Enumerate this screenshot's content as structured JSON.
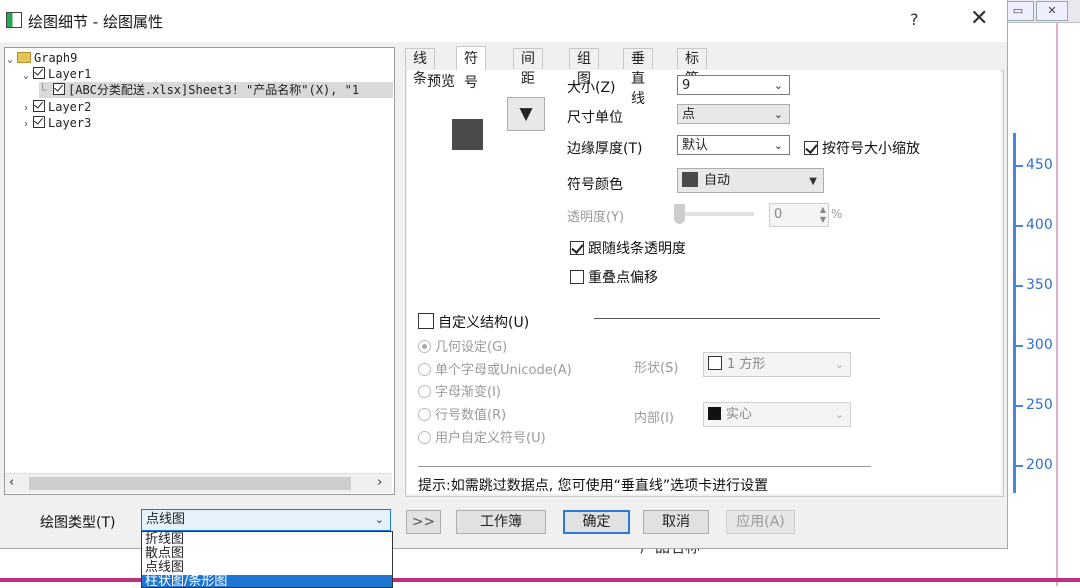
{
  "window": {
    "title": "绘图细节 - 绘图属性",
    "help": "?",
    "close": "✕"
  },
  "background": {
    "buttons": [
      "▭",
      "✕"
    ],
    "axis_ticks": [
      "450",
      "400",
      "350",
      "300",
      "250",
      "200"
    ],
    "behind_text": "产品名称"
  },
  "tree": {
    "root": "Graph9",
    "layer1": "Layer1",
    "plot": "[ABC分类配送.xlsx]Sheet3! \"产品名称\"(X), \"1",
    "layer2": "Layer2",
    "layer3": "Layer3"
  },
  "tabs": [
    "线条",
    "符号",
    "间距",
    "组图",
    "垂直线",
    "标签"
  ],
  "symbol": {
    "preview_label": "预览",
    "size_label": "大小(Z)",
    "size_value": "9",
    "unit_label": "尺寸单位",
    "unit_value": "点",
    "edge_label": "边缘厚度(T)",
    "edge_value": "默认",
    "scale_label": "按符号大小缩放",
    "color_label": "符号颜色",
    "color_value": "自动",
    "transparency_label": "透明度(Y)",
    "transparency_value": "0",
    "transparency_unit": "%",
    "follow_label": "跟随线条透明度",
    "overlap_label": "重叠点偏移"
  },
  "custom": {
    "title": "自定义结构(U)",
    "options": [
      "几何设定(G)",
      "单个字母或Unicode(A)",
      "字母渐变(I)",
      "行号数值(R)",
      "用户自定义符号(U)"
    ],
    "shape_label": "形状(S)",
    "shape_value": "1 方形",
    "interior_label": "内部(I)",
    "interior_value": "实心"
  },
  "hint": "提示:如需跳过数据点, 您可使用“垂直线”选项卡进行设置",
  "footer": {
    "plot_type_label": "绘图类型(T)",
    "plot_type_value": "点线图",
    "collapse_btn": ">>",
    "workbook_btn": "工作簿",
    "ok_btn": "确定",
    "cancel_btn": "取消",
    "apply_btn": "应用(A)"
  },
  "dropdown_options": [
    "折线图",
    "散点图",
    "点线图",
    "柱状图/条形图"
  ],
  "colors": {
    "accent": "#1e76d2",
    "axis": "#4a86d8",
    "symbol_fill": "#4a4a4a"
  }
}
